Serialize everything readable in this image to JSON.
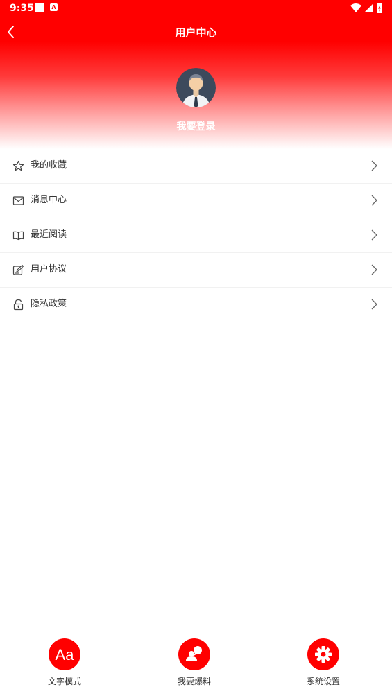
{
  "status_bar": {
    "time": "9:35",
    "notif_badge": "A"
  },
  "header": {
    "title": "用户中心",
    "login_label": "我要登录"
  },
  "menu": {
    "items": [
      {
        "label": "我的收藏",
        "icon": "star-icon"
      },
      {
        "label": "消息中心",
        "icon": "mail-icon"
      },
      {
        "label": "最近阅读",
        "icon": "book-icon"
      },
      {
        "label": "用户协议",
        "icon": "edit-icon"
      },
      {
        "label": "隐私政策",
        "icon": "lock-icon"
      }
    ]
  },
  "bottom_bar": {
    "items": [
      {
        "label": "文字模式",
        "icon": "text-mode-icon",
        "glyph": "Aa"
      },
      {
        "label": "我要爆料",
        "icon": "report-icon"
      },
      {
        "label": "系统设置",
        "icon": "gear-icon"
      }
    ]
  },
  "colors": {
    "accent": "#ff0000",
    "text": "#333333",
    "divider": "#f1f1f1"
  }
}
